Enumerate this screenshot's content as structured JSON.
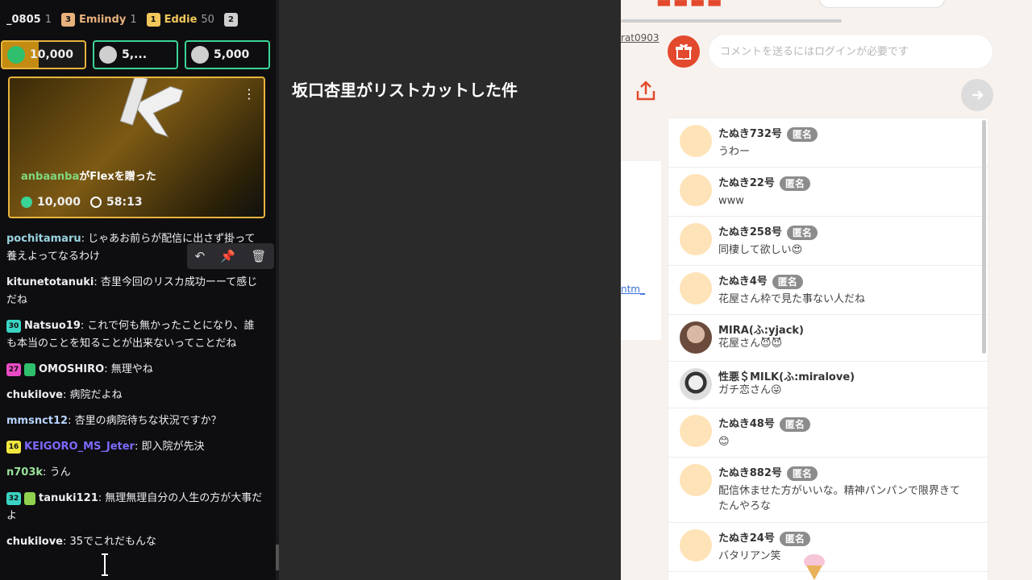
{
  "leaderboard": [
    {
      "rank": "",
      "name": "_0805",
      "score": "1",
      "color": "#ffffff"
    },
    {
      "rank": "3",
      "name": "Emiindy",
      "score": "1",
      "color": "#e8b17c"
    },
    {
      "rank": "1",
      "name": "Eddie",
      "score": "50",
      "color": "#f2c75c"
    },
    {
      "rank": "2",
      "name": "",
      "score": "",
      "color": "#cfcfcf"
    }
  ],
  "gifts": [
    {
      "value": "10,000"
    },
    {
      "value": "5,..."
    },
    {
      "value": "5,000"
    }
  ],
  "flex_card": {
    "sender": "anbaanba",
    "action": "がFlexを贈った",
    "amount": "10,000",
    "timer": "58:13"
  },
  "messages": [
    {
      "user": "pochitamaru",
      "text": "じゃあお前らが配信に出さず掛って養えよってなるわけ",
      "color": "#9ad4e2",
      "badge": ""
    },
    {
      "user": "kitunetotanuki",
      "text": "杏里今回のリスカ成功ーーて感じだね",
      "color": "#ffffff",
      "badge": ""
    },
    {
      "user": "Natsuo19",
      "text": "これで何も無かったことになり、誰も本当のことを知ることが出来ないってことだね",
      "color": "#ffffff",
      "badge": "30",
      "badge_color": "#3ad4c4"
    },
    {
      "user": "OMOSHIRO",
      "text": "無理やね",
      "color": "#ffffff",
      "badge": "27",
      "badge_color": "#e84cc4"
    },
    {
      "user": "chukilove",
      "text": "病院だよね",
      "color": "#ffffff",
      "badge": ""
    },
    {
      "user": "mmsnct12",
      "text": "杏里の病院待ちな状況ですか？",
      "color": "#b7d4ff",
      "badge": ""
    },
    {
      "user": "KEIGORO_MS_Jeter",
      "text": "即入院が先決",
      "color": "#7b6bff",
      "badge": "16",
      "badge_color": "#f2e640"
    },
    {
      "user": "n703k",
      "text": "うん",
      "color": "#9ae29a",
      "badge": ""
    },
    {
      "user": "tanuki121",
      "text": "無理無理自分の人生の方が大事だよ",
      "color": "#ffffff",
      "badge": "32",
      "badge_color": "#3ad4c4"
    },
    {
      "user": "chukilove",
      "text": "35でこれだもんな",
      "color": "#ffffff",
      "badge": ""
    }
  ],
  "middle_title": "坂口杏里がリストカットした件",
  "right": {
    "user_id": "rat0903",
    "partial_link": "ntm_",
    "comment_placeholder": "コメントを送るにはログインが必要です",
    "anon_label": "匿名",
    "comments": [
      {
        "name": "たぬき732号",
        "anon": true,
        "text": "うわー"
      },
      {
        "name": "たぬき22号",
        "anon": true,
        "text": "www"
      },
      {
        "name": "たぬき258号",
        "anon": true,
        "text": "同棲して欲しい😍"
      },
      {
        "name": "たぬき4号",
        "anon": true,
        "text": "花屋さん枠で見た事ない人だね"
      },
      {
        "name": "MIRA(ふ:yjack)",
        "anon": false,
        "text": "花屋さん😈😈"
      },
      {
        "name": "性悪＄MILK(ふ:miralove)",
        "anon": false,
        "text": "ガチ恋さん😜"
      },
      {
        "name": "たぬき48号",
        "anon": true,
        "text": "😊"
      },
      {
        "name": "たぬき882号",
        "anon": true,
        "text": "配信休ませた方がいいな。精神パンパンで限界きてたんやろな"
      },
      {
        "name": "たぬき24号",
        "anon": true,
        "text": "バタリアン笑"
      }
    ]
  }
}
